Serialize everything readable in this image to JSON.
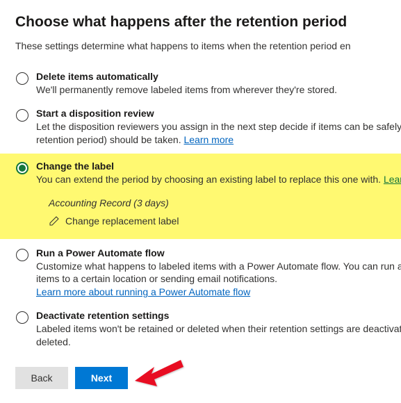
{
  "title": "Choose what happens after the retention period",
  "subtitle_prefix": "These settings determine what happens to items when the retention period en",
  "options": {
    "delete": {
      "title": "Delete items automatically",
      "desc": "We'll permanently remove labeled items from wherever they're stored."
    },
    "disposition": {
      "title": "Start a disposition review",
      "desc_a": "Let the disposition reviewers you assign in the next step decide if items can be safely d",
      "desc_b": "retention period) should be taken. ",
      "learn": "Learn more"
    },
    "change": {
      "title": "Change the label",
      "desc": "You can extend the period by choosing an existing label to replace this one with. ",
      "learn": "Learn ",
      "current_label": "Accounting Record (3 days)",
      "edit_link": "Change replacement label"
    },
    "flow": {
      "title": "Run a Power Automate flow",
      "desc_a": "Customize what happens to labeled items with a Power Automate flow. You can run a f",
      "desc_b": "items to a certain location or sending email notifications.",
      "learn": "Learn more about running a Power Automate flow"
    },
    "deactivate": {
      "title": "Deactivate retention settings",
      "desc_a": "Labeled items won't be retained or deleted when their retention settings are deactivat",
      "desc_b": "deleted."
    }
  },
  "buttons": {
    "back": "Back",
    "next": "Next"
  }
}
